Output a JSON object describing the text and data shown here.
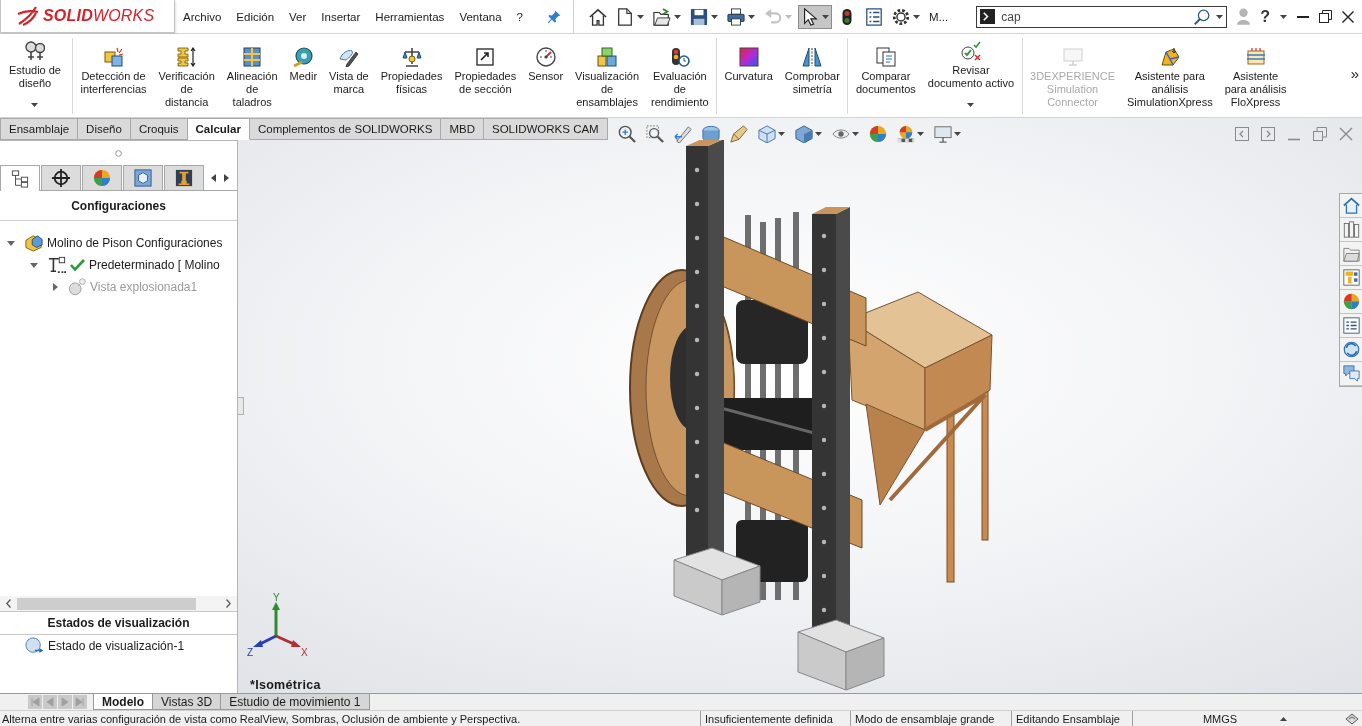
{
  "title_bar": {
    "logo_text": "**SOLID**WORKS",
    "menu": [
      "Archivo",
      "Edición",
      "Ver",
      "Insertar",
      "Herramientas",
      "Ventana",
      "?"
    ],
    "quick_access": [
      {
        "dropdown": false,
        "pressed": false,
        "disabled": false
      },
      {
        "dropdown": true,
        "pressed": false,
        "disabled": false
      },
      {
        "dropdown": true,
        "pressed": false,
        "disabled": false
      },
      {
        "dropdown": true,
        "pressed": false,
        "disabled": false
      },
      {
        "dropdown": true,
        "pressed": false,
        "disabled": false
      },
      {
        "dropdown": true,
        "pressed": false,
        "disabled": true
      },
      {
        "dropdown": true,
        "pressed": true,
        "disabled": false
      },
      {
        "dropdown": false,
        "pressed": false,
        "disabled": false
      },
      {
        "dropdown": false,
        "pressed": false,
        "disabled": false
      },
      {
        "dropdown": true,
        "pressed": false,
        "disabled": false
      }
    ],
    "overflow_label": "M...",
    "search": {
      "value": "cap"
    },
    "help_label": "?"
  },
  "command_manager": {
    "groups": [
      {
        "items": [
          {
            "label": "Estudio de\ndiseño",
            "dropdown": true,
            "disabled": false
          }
        ]
      },
      {
        "items": [
          {
            "label": "Detección de\ninterferencias",
            "dropdown": false,
            "disabled": false
          },
          {
            "label": "Verificación\nde\ndistancia",
            "dropdown": false,
            "disabled": false
          },
          {
            "label": "Alineación\nde\ntaladros",
            "dropdown": false,
            "disabled": false
          },
          {
            "label": "Medir",
            "dropdown": false,
            "disabled": false
          },
          {
            "label": "Vista de\nmarca",
            "dropdown": false,
            "disabled": false
          },
          {
            "label": "Propiedades\nfísicas",
            "dropdown": false,
            "disabled": false
          },
          {
            "label": "Propiedades\nde sección",
            "dropdown": false,
            "disabled": false
          },
          {
            "label": "Sensor",
            "dropdown": false,
            "disabled": false
          },
          {
            "label": "Visualización\nde\nensamblajes",
            "dropdown": false,
            "disabled": false
          },
          {
            "label": "Evaluación\nde\nrendimiento",
            "dropdown": false,
            "disabled": false
          }
        ]
      },
      {
        "items": [
          {
            "label": "Curvatura",
            "dropdown": false,
            "disabled": false
          },
          {
            "label": "Comprobar\nsimetría",
            "dropdown": false,
            "disabled": false
          }
        ]
      },
      {
        "items": [
          {
            "label": "Comparar\ndocumentos",
            "dropdown": false,
            "disabled": false
          },
          {
            "label": "Revisar\ndocumento activo",
            "dropdown": true,
            "disabled": false
          }
        ]
      },
      {
        "items": [
          {
            "label": "3DEXPERIENCE\nSimulation\nConnector",
            "dropdown": false,
            "disabled": true
          },
          {
            "label": "Asistente para\nanálisis\nSimulationXpress",
            "dropdown": false,
            "disabled": false
          },
          {
            "label": "Asistente\npara análisis\nFloXpress",
            "dropdown": false,
            "disabled": false
          }
        ]
      }
    ],
    "overflow": "»"
  },
  "tabs": [
    {
      "label": "Ensamblaje",
      "selected": false
    },
    {
      "label": "Diseño",
      "selected": false
    },
    {
      "label": "Croquis",
      "selected": false
    },
    {
      "label": "Calcular",
      "selected": true
    },
    {
      "label": "Complementos de SOLIDWORKS",
      "selected": false
    },
    {
      "label": "MBD",
      "selected": false
    },
    {
      "label": "SOLIDWORKS CAM",
      "selected": false
    }
  ],
  "left_panel": {
    "tabs": [
      {
        "selected": true
      },
      {
        "selected": false
      },
      {
        "selected": false
      },
      {
        "selected": false
      },
      {
        "selected": false
      }
    ],
    "title": "Configuraciones",
    "tree": [
      {
        "label": "Molino de Pison Configuraciones",
        "expanded": true,
        "active": false,
        "dimmed": false,
        "children": [
          {
            "label": "Predeterminado [ Molino",
            "expanded": true,
            "active": true,
            "dimmed": false,
            "children": [
              {
                "label": "Vista explosionada1",
                "expanded": false,
                "active": false,
                "dimmed": true
              }
            ]
          }
        ]
      }
    ],
    "display_states_title": "Estados de visualización",
    "display_states": [
      {
        "label": "Estado de visualización-1"
      }
    ]
  },
  "viewport": {
    "view_name": "*Isométrica",
    "triad": {
      "x": "X",
      "y": "Y",
      "z": "Z"
    }
  },
  "bottom_tabs": [
    {
      "label": "Modelo",
      "selected": true
    },
    {
      "label": "Vistas 3D",
      "selected": false
    },
    {
      "label": "Estudio de movimiento 1",
      "selected": false
    }
  ],
  "status_bar": {
    "message": "Alterna entre varias configuración de vista como RealView, Sombras, Oclusión de ambiente y Perspectiva.",
    "fields": [
      "Insuficientemente definida",
      "Modo de ensamblaje grande",
      "Editando Ensamblaje"
    ],
    "units": "MMGS"
  }
}
